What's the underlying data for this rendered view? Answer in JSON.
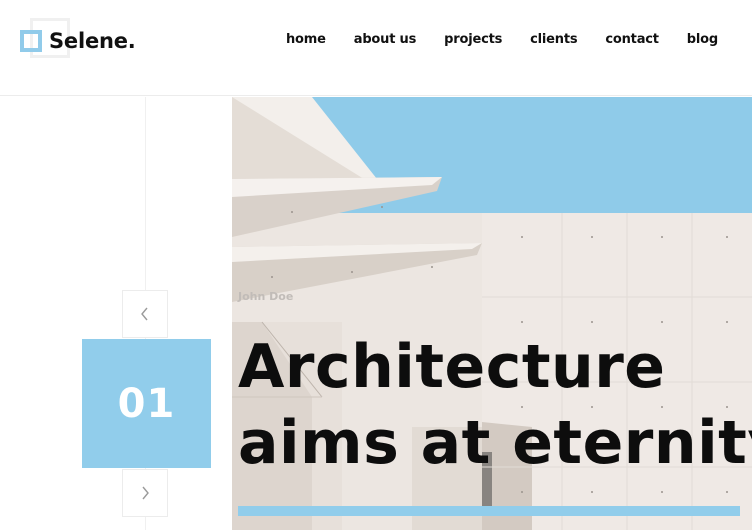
{
  "brand": {
    "name": "Selene.",
    "accent_color": "#91cdeb"
  },
  "nav": {
    "items": [
      {
        "label": "home"
      },
      {
        "label": "about us"
      },
      {
        "label": "projects"
      },
      {
        "label": "clients"
      },
      {
        "label": "contact"
      },
      {
        "label": "blog"
      }
    ]
  },
  "slider": {
    "current_number": "01",
    "prev_icon": "chevron-left-icon",
    "next_icon": "chevron-right-icon"
  },
  "hero": {
    "author": "John Doe",
    "title_line_1": "Architecture",
    "title_line_2": "aims at eternity",
    "sky_color": "#8fcbe9",
    "wall_color": "#ece6e1"
  }
}
